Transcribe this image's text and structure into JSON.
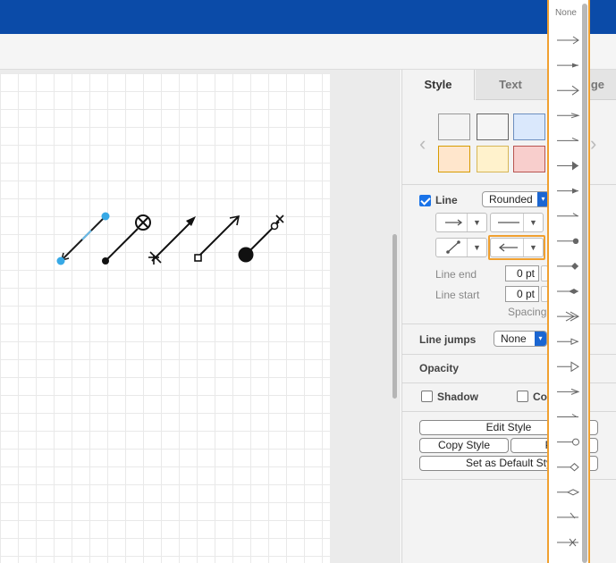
{
  "tabs": {
    "style": "Style",
    "text": "Text",
    "arrange": "ge"
  },
  "line": {
    "label": "Line",
    "checked": true,
    "waypoint_style": "Rounded",
    "line_end_label": "Line end",
    "line_end_value": "0 pt",
    "line_start_label": "Line start",
    "line_start_value": "0 pt",
    "spacing_label": "Spacing"
  },
  "line_jumps": {
    "label": "Line jumps",
    "value": "None"
  },
  "opacity": {
    "label": "Opacity"
  },
  "shadow": {
    "label": "Shadow",
    "checked": false
  },
  "copy_toggle": {
    "label": "Co",
    "checked": false
  },
  "buttons": {
    "edit_style": "Edit Style",
    "copy_style": "Copy Style",
    "paste_style": "Pas",
    "set_default": "Set as Default Sty"
  },
  "swatches": [
    "#ffffff",
    "#f5f5f5",
    "#dae8fc",
    "#ffe6cc",
    "#fff2cc",
    "#f8cecc"
  ],
  "arrow_menu": {
    "none_label": "None",
    "items": [
      "classic",
      "classic-thin",
      "open",
      "open-thin",
      "block",
      "block-thin",
      "block-filled",
      "block-thin-filled",
      "oval",
      "diamond",
      "diamond-thin",
      "open-async",
      "async",
      "box",
      "half-circle",
      "dash",
      "cross",
      "circle-plus",
      "circle",
      "erd-one",
      "erd-many",
      "erd-zero-to-one"
    ]
  },
  "colors": {
    "accent": "#1a73e8",
    "highlight": "#f0a030",
    "titlebar": "#0b4ba8"
  }
}
